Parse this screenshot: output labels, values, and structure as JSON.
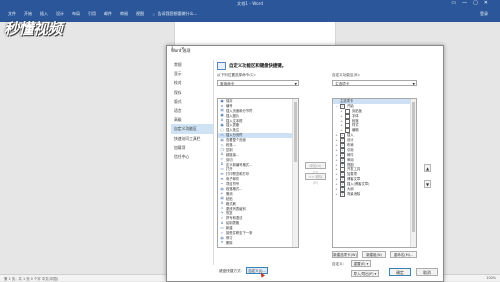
{
  "window": {
    "title": "文档1 - Word",
    "controls": [
      "▭",
      "—",
      "▢",
      "✕"
    ],
    "tabs": [
      "文件",
      "开始",
      "插入",
      "设计",
      "布局",
      "引用",
      "邮件",
      "审阅",
      "视图"
    ],
    "tell_me": "告诉我您想要做什么...",
    "user": "登录",
    "accent": "#2b579a"
  },
  "watermark": "秒懂视频",
  "statusbar": {
    "left": "第 1 页，共 1 页    0 个字    中文(中国)",
    "right": "100%"
  },
  "dialog": {
    "title": "Word 选项",
    "controls": "? ✕",
    "nav": [
      "常规",
      "显示",
      "校对",
      "保存",
      "版式",
      "语言",
      "高级",
      "自定义功能区",
      "快速访问工具栏",
      "加载项",
      "信任中心"
    ],
    "nav_selected": 7,
    "heading": "自定义功能区和键盘快捷键。",
    "choose_from_label": "从下列位置选择命令(C):",
    "choose_from_value": "常用命令",
    "customize_label": "自定义功能区(B):",
    "customize_value": "主选项卡",
    "commands": [
      {
        "icon": "save-icon",
        "glyph": "▣",
        "label": "保存"
      },
      {
        "icon": "number-icon",
        "glyph": "≡",
        "label": "编号"
      },
      {
        "icon": "paste-icon",
        "glyph": "▤",
        "label": "插入页面和分节符"
      },
      {
        "icon": "picture-icon",
        "glyph": "▦",
        "label": "插入图片"
      },
      {
        "icon": "textbox-icon",
        "glyph": "A",
        "label": "插入文本框"
      },
      {
        "icon": "table-icon",
        "glyph": "▦",
        "label": "插入表格"
      },
      {
        "icon": "comment-icon",
        "glyph": "▢",
        "label": "插入批注"
      },
      {
        "icon": "pagebreak-icon",
        "glyph": "▭",
        "label": "插入分页符"
      },
      {
        "icon": "print-icon",
        "glyph": "▤",
        "label": "查看整个页面"
      },
      {
        "icon": "shape-icon",
        "glyph": "◇",
        "label": "段落..."
      },
      {
        "icon": "copy-icon",
        "glyph": "❐",
        "label": "复制"
      },
      {
        "icon": "font-icon",
        "glyph": "A",
        "label": "超链接..."
      },
      {
        "icon": "cut-icon",
        "glyph": "✂",
        "label": "剪切"
      },
      {
        "icon": "define-icon",
        "glyph": "D",
        "label": "定义新编号格式..."
      },
      {
        "icon": "open-icon",
        "glyph": "▭",
        "label": "打开"
      },
      {
        "icon": "email-icon",
        "glyph": "✉",
        "label": "打印预览和打印"
      },
      {
        "icon": "mail-icon",
        "glyph": "✉",
        "label": "电子邮件"
      },
      {
        "icon": "bullet-icon",
        "glyph": "•",
        "label": "项目符号"
      },
      {
        "icon": "paste-icon",
        "glyph": "▤",
        "label": "段落格式..."
      },
      {
        "icon": "undo-icon",
        "glyph": "↶",
        "label": "撤消"
      },
      {
        "icon": "paste-icon",
        "glyph": "▤",
        "label": "粘贴"
      },
      {
        "icon": "format-icon",
        "glyph": "A",
        "label": "格式刷"
      },
      {
        "icon": "shape-icon",
        "glyph": "◇",
        "label": "更改列表级别"
      },
      {
        "icon": "redo-icon",
        "glyph": "↷",
        "label": "恢复"
      },
      {
        "icon": "spell-icon",
        "glyph": "✓",
        "label": "拼写和语法"
      },
      {
        "icon": "font-icon",
        "glyph": "A",
        "label": "绘制表格"
      },
      {
        "icon": "new-icon",
        "glyph": "▭",
        "label": "新建"
      },
      {
        "icon": "accept-icon",
        "glyph": "✓",
        "label": "接受并移至下一条"
      },
      {
        "icon": "track-icon",
        "glyph": "▤",
        "label": "修订"
      },
      {
        "icon": "delete-icon",
        "glyph": "✕",
        "label": "删除"
      }
    ],
    "add_button": "添加(A) >>",
    "remove_button": "<< 删除(R)",
    "tree": [
      {
        "level": 0,
        "toggle": "",
        "checked": false,
        "label": "主选项卡"
      },
      {
        "level": 0,
        "toggle": "−",
        "checked": true,
        "label": "开始"
      },
      {
        "level": 1,
        "toggle": "+",
        "checked": false,
        "label": "剪贴板"
      },
      {
        "level": 1,
        "toggle": "+",
        "checked": false,
        "label": "字体"
      },
      {
        "level": 1,
        "toggle": "+",
        "checked": false,
        "label": "段落"
      },
      {
        "level": 1,
        "toggle": "+",
        "checked": false,
        "label": "样式"
      },
      {
        "level": 1,
        "toggle": "+",
        "checked": false,
        "label": "编辑"
      },
      {
        "level": 0,
        "toggle": "+",
        "checked": true,
        "label": "插入"
      },
      {
        "level": 0,
        "toggle": "+",
        "checked": true,
        "label": "设计"
      },
      {
        "level": 0,
        "toggle": "+",
        "checked": true,
        "label": "布局"
      },
      {
        "level": 0,
        "toggle": "+",
        "checked": true,
        "label": "引用"
      },
      {
        "level": 0,
        "toggle": "+",
        "checked": true,
        "label": "邮件"
      },
      {
        "level": 0,
        "toggle": "+",
        "checked": true,
        "label": "审阅"
      },
      {
        "level": 0,
        "toggle": "+",
        "checked": true,
        "label": "视图"
      },
      {
        "level": 0,
        "toggle": "+",
        "checked": false,
        "label": "开发工具"
      },
      {
        "level": 0,
        "toggle": "+",
        "checked": true,
        "label": "加载项"
      },
      {
        "level": 0,
        "toggle": "+",
        "checked": true,
        "label": "博客文章"
      },
      {
        "level": 0,
        "toggle": "+",
        "checked": true,
        "label": "插入(博客文章)"
      },
      {
        "level": 0,
        "toggle": "+",
        "checked": true,
        "label": "大纲"
      },
      {
        "level": 0,
        "toggle": "+",
        "checked": true,
        "label": "背景消除"
      }
    ],
    "new_tab_button": "新建选项卡(W)",
    "new_group_button": "新建组(N)",
    "rename_button": "重命名(M)...",
    "customizations_label": "自定义:",
    "reset_button": "重置(E) ▾",
    "import_export_button": "导入/导出(P) ▾",
    "keyboard_label": "键盘快捷方式:",
    "keyboard_button": "自定义(I)...",
    "ok_button": "确定",
    "cancel_button": "取消",
    "move_up": "▲",
    "move_down": "▼"
  }
}
